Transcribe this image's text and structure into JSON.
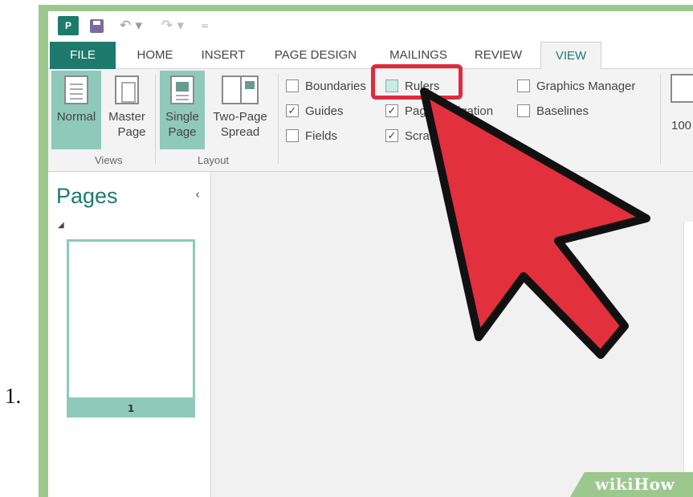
{
  "step_label": "1.",
  "qat": {
    "logo_text": "P",
    "undo_symbol": "↶ ▾",
    "redo_symbol": "↷ ▾",
    "customize_symbol": "="
  },
  "tabs": [
    {
      "label": "FILE"
    },
    {
      "label": "HOME"
    },
    {
      "label": "INSERT"
    },
    {
      "label": "PAGE DESIGN"
    },
    {
      "label": "MAILINGS"
    },
    {
      "label": "REVIEW"
    },
    {
      "label": "VIEW"
    }
  ],
  "ribbon": {
    "views": {
      "normal_line1": "Normal",
      "master_line1": "Master",
      "master_line2": "Page",
      "group_label": "Views"
    },
    "layout": {
      "single_line1": "Single",
      "single_line2": "Page",
      "two_line1": "Two-Page",
      "two_line2": "Spread",
      "group_label": "Layout"
    },
    "show": {
      "boundaries": "Boundaries",
      "guides": "Guides",
      "fields": "Fields",
      "rulers": "Rulers",
      "page_navigation": "Page Navigation",
      "scratch_area": "Scratch Area",
      "graphics_manager": "Graphics Manager",
      "baselines": "Baselines",
      "checkmark": "✓"
    },
    "zoom_label": "100"
  },
  "pages_pane": {
    "title": "Pages",
    "collapse_symbol": "‹",
    "expand_symbol": "◢",
    "page_number": "1"
  },
  "colors": {
    "accent": "#1e7a6d",
    "selected": "#8fc9ba",
    "highlight_box": "#e02a3c",
    "arrow_fill": "#e2303d"
  },
  "watermark": {
    "wiki": "wiki",
    "how": "How"
  }
}
